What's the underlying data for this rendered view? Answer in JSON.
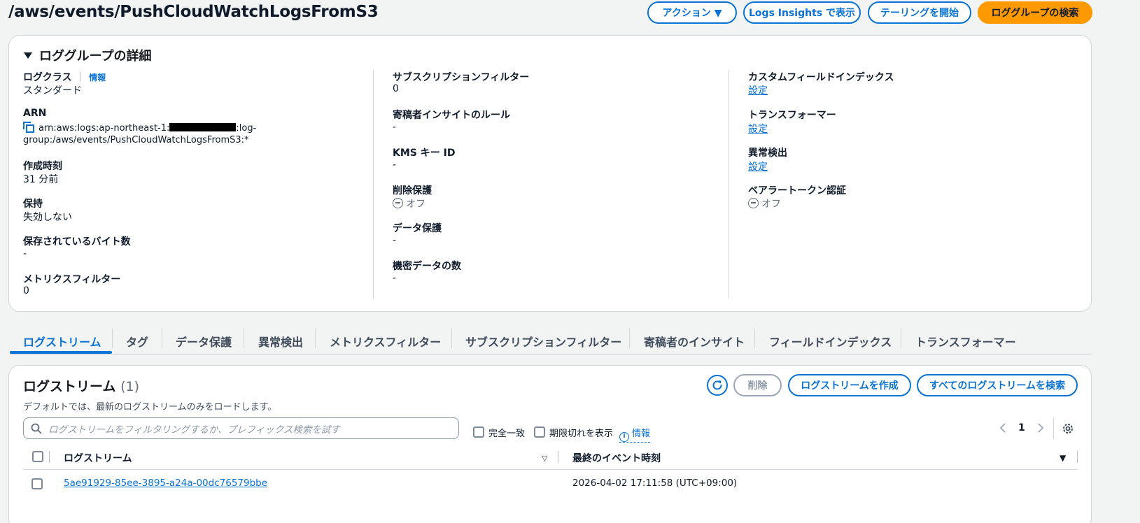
{
  "header": {
    "title": "/aws/events/PushCloudWatchLogsFromS3",
    "actions_label": "アクション ▼",
    "logs_insights_label": "Logs Insights で表示",
    "tailing_label": "テーリングを開始",
    "search_group_label": "ロググループの検索"
  },
  "details": {
    "heading": "ロググループの詳細",
    "col1": {
      "log_class_label": "ログクラス",
      "info_label": "情報",
      "log_class_value": "スタンダード",
      "arn_label": "ARN",
      "arn_line1_prefix": "arn:aws:logs:ap-northeast-1:",
      "arn_line1_suffix": ":log-",
      "arn_line2": "group:/aws/events/PushCloudWatchLogsFromS3:*",
      "created_label": "作成時刻",
      "created_value": "31 分前",
      "retention_label": "保持",
      "retention_value": "失効しない",
      "stored_bytes_label": "保存されているバイト数",
      "stored_bytes_value": "-",
      "metric_filter_label": "メトリクスフィルター",
      "metric_filter_value": "0"
    },
    "col2": {
      "subscription_label": "サブスクリプションフィルター",
      "subscription_value": "0",
      "contributor_label": "寄稿者インサイトのルール",
      "contributor_value": "-",
      "kms_label": "KMS キー ID",
      "kms_value": "-",
      "deletion_label": "削除保護",
      "deletion_value": "オフ",
      "data_protection_label": "データ保護",
      "data_protection_value": "-",
      "sensitive_label": "機密データの数",
      "sensitive_value": "-"
    },
    "col3": {
      "custom_index_label": "カスタムフィールドインデックス",
      "custom_index_link": "設定",
      "transformer_label": "トランスフォーマー",
      "transformer_link": "設定",
      "anomaly_label": "異常検出",
      "anomaly_link": "設定",
      "bearer_label": "ベアラートークン認証",
      "bearer_value": "オフ"
    }
  },
  "tabs": [
    "ログストリーム",
    "タグ",
    "データ保護",
    "異常検出",
    "メトリクスフィルター",
    "サブスクリプションフィルター",
    "寄稿者のインサイト",
    "フィールドインデックス",
    "トランスフォーマー"
  ],
  "streams": {
    "title": "ログストリーム",
    "count": "(1)",
    "description": "デフォルトでは、最新のログストリームのみをロードします。",
    "delete_label": "削除",
    "create_label": "ログストリームを作成",
    "search_all_label": "すべてのログストリームを検索",
    "filter_placeholder": "ログストリームをフィルタリングするか、プレフィックス検索を試す",
    "exact_match_label": "完全一致",
    "show_expired_label": "期限切れを表示",
    "info_label": "情報",
    "page_number": "1",
    "col_stream": "ログストリーム",
    "col_last_event": "最終のイベント時刻",
    "rows": [
      {
        "name": "5ae91929-85ee-3895-a24a-00dc76579bbe",
        "last_event": "2026-04-02 17:11:58 (UTC+09:00)"
      }
    ]
  }
}
